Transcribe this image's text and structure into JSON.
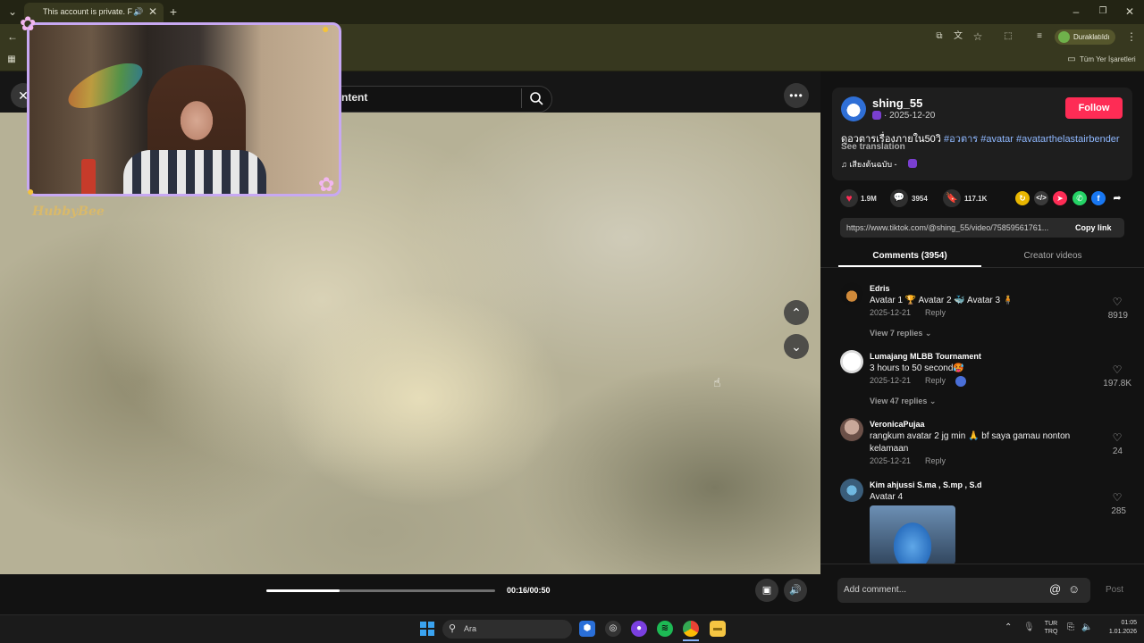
{
  "browser": {
    "tab_title": "This account is private. Follow",
    "profile_label": "Duraklatıldı",
    "bookmarks_label": "Tüm Yer İşaretleri"
  },
  "video": {
    "search_placeholder": "ntent",
    "time": "00:16/00:50",
    "progress": 0.32
  },
  "webcam": {
    "caption": "HubbyBee"
  },
  "post": {
    "username": "shing_55",
    "date": "· 2025-12-20",
    "follow_label": "Follow",
    "desc_text": "ดูอวตารเรื่องภายใน50วิ ",
    "tags": [
      "#อวตาร",
      "#avatar",
      "#avatarthelastairbender"
    ],
    "see_translation": "See translation",
    "music": "♫ เสียงต้นฉบับ -",
    "likes": "1.9M",
    "comments": "3954",
    "saves": "117.1K",
    "link_url": "https://www.tiktok.com/@shing_55/video/75859561761...",
    "copy_link_label": "Copy link"
  },
  "tabs": {
    "comments_label": "Comments (3954)",
    "creator_label": "Creator videos"
  },
  "comments": [
    {
      "name": "Edris",
      "text": "Avatar 1 🏆 Avatar 2 🐳 Avatar 3 🧍",
      "date": "2025-12-21",
      "reply": "Reply",
      "likes": "8919",
      "view_replies": "View 7 replies"
    },
    {
      "name": "Lumajang MLBB Tournament",
      "text": "3 hours to 50 second🥵",
      "date": "2025-12-21",
      "reply": "Reply",
      "likes": "197.8K",
      "view_replies": "View 47 replies"
    },
    {
      "name": "VeronicaPujaa",
      "text": "rangkum avatar 2 jg min 🙏 bf saya gamau nonton kelamaan",
      "date": "2025-12-21",
      "reply": "Reply",
      "likes": "24"
    },
    {
      "name": "Kim ahjussi S.ma , S.mp , S.d",
      "text": "Avatar 4",
      "likes": "285"
    }
  ],
  "add_comment": {
    "placeholder": "Add comment...",
    "post_label": "Post"
  },
  "taskbar": {
    "search_label": "Ara",
    "lang_line1": "TUR",
    "lang_line2": "TRQ",
    "time": "01:05",
    "date": "1.01.2026"
  },
  "colors": {
    "accent": "#fe2c55",
    "tag": "#8fb8ff",
    "chrome": "#37381f"
  }
}
